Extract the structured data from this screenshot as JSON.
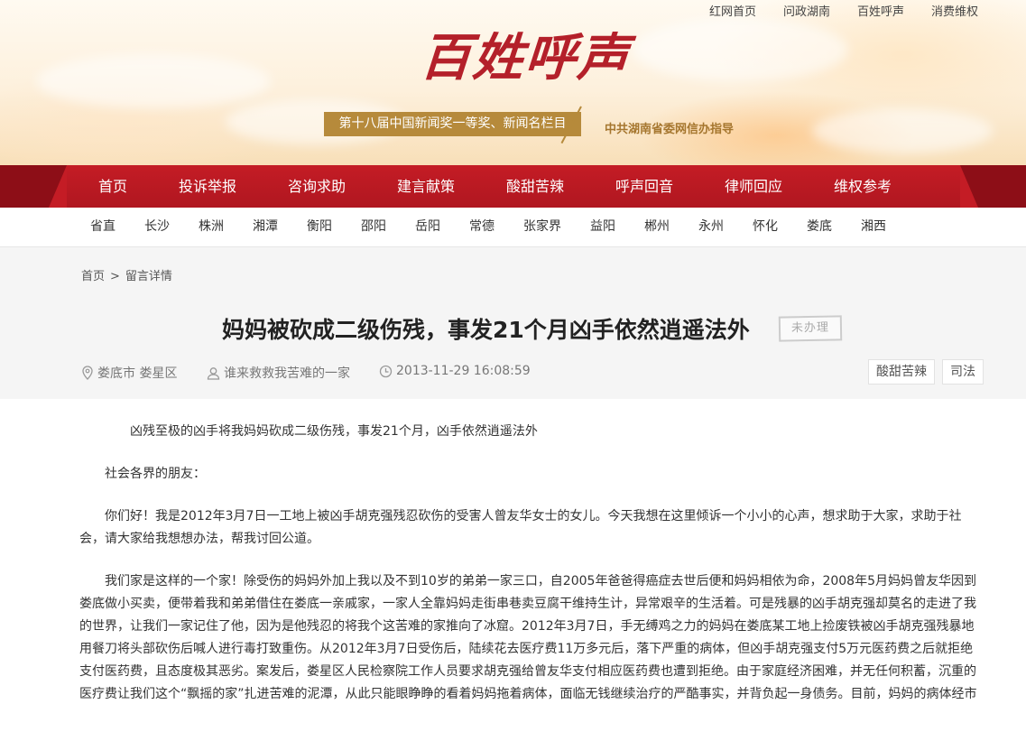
{
  "header": {
    "top_links": [
      "红网首页",
      "问政湖南",
      "百姓呼声",
      "消费维权"
    ],
    "logo_text": "百姓呼声",
    "award": "第十八届中国新闻奖一等奖、新闻名栏目",
    "guide": "中共湖南省委网信办指导"
  },
  "main_nav": [
    "首页",
    "投诉举报",
    "咨询求助",
    "建言献策",
    "酸甜苦辣",
    "呼声回音",
    "律师回应",
    "维权参考"
  ],
  "region_nav": [
    "省直",
    "长沙",
    "株洲",
    "湘潭",
    "衡阳",
    "邵阳",
    "岳阳",
    "常德",
    "张家界",
    "益阳",
    "郴州",
    "永州",
    "怀化",
    "娄底",
    "湘西"
  ],
  "breadcrumb": {
    "home": "首页",
    "separator": ">",
    "current": "留言详情"
  },
  "post": {
    "title": "妈妈被砍成二级伤残，事发21个月凶手依然逍遥法外",
    "status": "未办理",
    "location": "娄底市 娄星区",
    "author": "谁来救救我苦难的一家",
    "time": "2013-11-29 16:08:59",
    "tags": [
      "酸甜苦辣",
      "司法"
    ]
  },
  "article": {
    "paragraphs": [
      "凶残至极的凶手将我妈妈砍成二级伤残，事发21个月，凶手依然逍遥法外",
      "社会各界的朋友：",
      "你们好！我是2012年3月7日一工地上被凶手胡克强残忍砍伤的受害人曾友华女士的女儿。今天我想在这里倾诉一个小小的心声，想求助于大家，求助于社会，请大家给我想想办法，帮我讨回公道。",
      "我们家是这样的一个家！除受伤的妈妈外加上我以及不到10岁的弟弟一家三口，自2005年爸爸得癌症去世后便和妈妈相依为命，2008年5月妈妈曾友华因到娄底做小买卖，便带着我和弟弟借住在娄底一亲戚家，一家人全靠妈妈走街串巷卖豆腐干维持生计，异常艰辛的生活着。可是残暴的凶手胡克强却莫名的走进了我的世界，让我们一家记住了他，因为是他残忍的将我个这苦难的家推向了冰窟。2012年3月7日，手无缚鸡之力的妈妈在娄底某工地上捡废铁被凶手胡克强残暴地用餐刀将头部砍伤后喊人进行毒打致重伤。从2012年3月7日受伤后，陆续花去医疗费11万多元后，落下严重的病体，但凶手胡克强支付5万元医药费之后就拒绝支付医药费，且态度极其恶劣。案发后，娄星区人民检察院工作人员要求胡克强给曾友华支付相应医药费也遭到拒绝。由于家庭经济困难，并无任何积蓄，沉重的医疗费让我们这个“飘摇的家”扎进苦难的泥潭，从此只能眼睁睁的看着妈妈拖着病体，面临无钱继续治疗的严酷事实，并背负起一身债务。目前，妈妈的病体经市"
    ]
  },
  "colors": {
    "brand_red": "#b4202a",
    "nav_red": "#c41c25",
    "gold": "#b68a3b"
  }
}
